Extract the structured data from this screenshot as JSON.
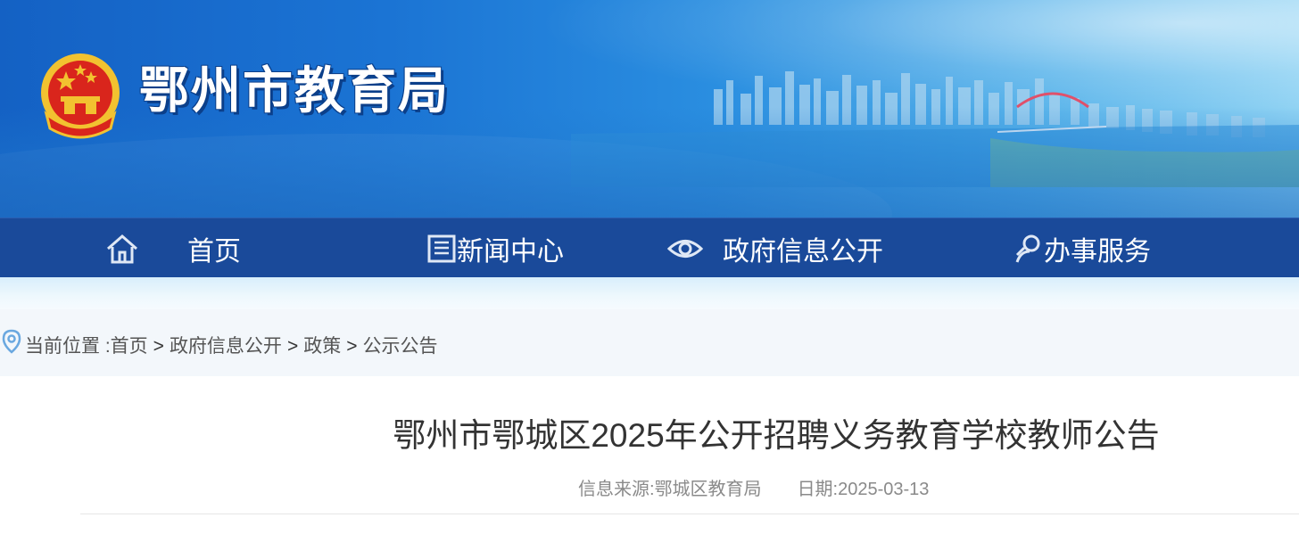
{
  "header": {
    "site_title": "鄂州市教育局",
    "emblem_icon": "national-emblem-icon",
    "colors": {
      "banner": "#1b74d4",
      "title_shadow": "#0b3f8a",
      "emblem_red": "#d9251c",
      "emblem_gold": "#f2c230"
    }
  },
  "nav": {
    "bg_color": "#1a4a9a",
    "items": [
      {
        "label": "首页",
        "icon": "home-icon"
      },
      {
        "label": "新闻中心",
        "icon": "newspaper-icon"
      },
      {
        "label": "政府信息公开",
        "icon": "eye-icon"
      },
      {
        "label": "办事服务",
        "icon": "service-person-icon"
      }
    ]
  },
  "breadcrumb": {
    "icon": "location-pin-icon",
    "prefix": "当前位置 :",
    "separator": ">",
    "items": [
      "首页",
      "政府信息公开",
      "政策",
      "公示公告"
    ]
  },
  "article": {
    "title": "鄂州市鄂城区2025年公开招聘义务教育学校教师公告",
    "source_label": "信息来源:",
    "source_value": "鄂城区教育局",
    "date_label": "日期:",
    "date_value": "2025-03-13"
  }
}
